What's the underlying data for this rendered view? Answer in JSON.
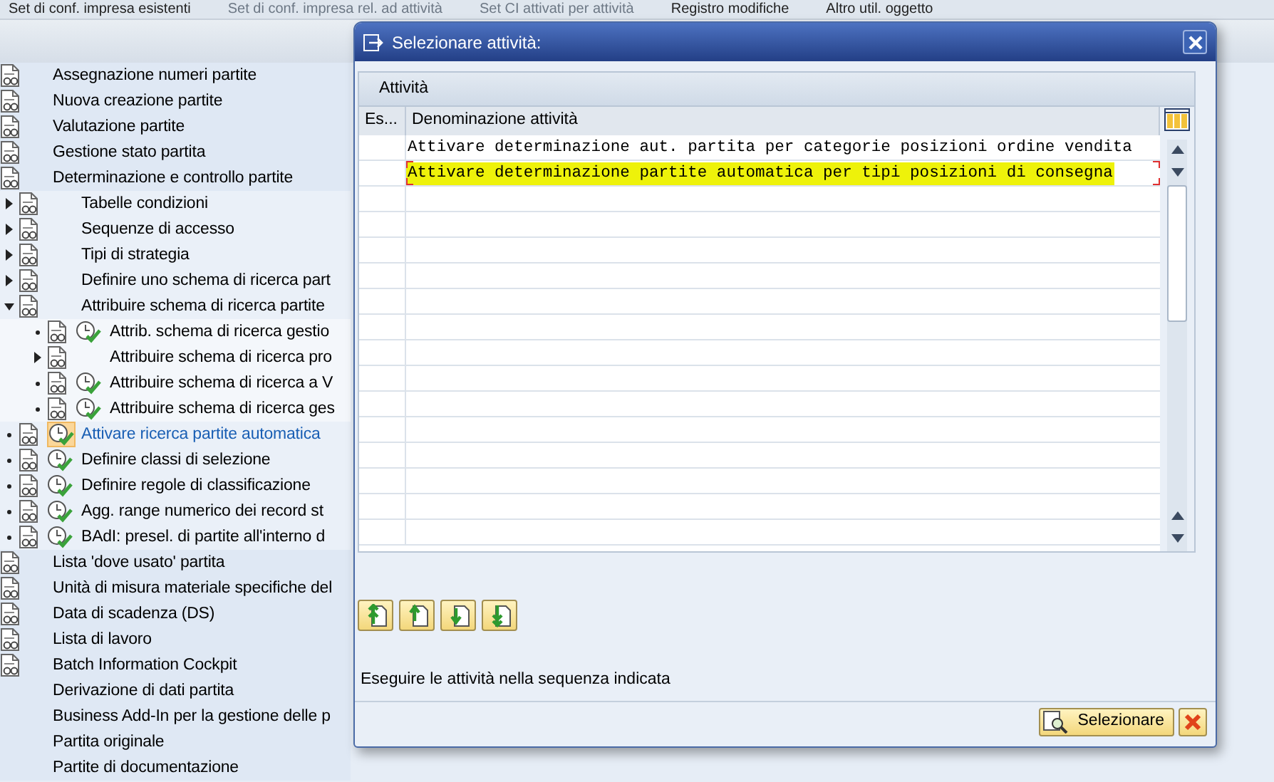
{
  "toolbar": [
    "Set di conf. impresa esistenti",
    "Set di conf. impresa rel. ad attività",
    "Set CI attivati per attività",
    "Registro modifiche",
    "Altro util. oggetto"
  ],
  "tree": [
    {
      "label": "Assegnazione numeri partite",
      "kind": "doc",
      "selected": false
    },
    {
      "label": "Nuova creazione partite",
      "kind": "doc",
      "selected": false
    },
    {
      "label": "Valutazione partite",
      "kind": "doc",
      "selected": false
    },
    {
      "label": "Gestione stato partita",
      "kind": "doc",
      "selected": false
    },
    {
      "label": "Determinazione e controllo partite",
      "kind": "doc",
      "selected": false,
      "children": [
        {
          "label": "Tabelle condizioni",
          "kind": "doc",
          "expanded": false,
          "selected": false
        },
        {
          "label": "Sequenze di accesso",
          "kind": "doc",
          "expanded": false,
          "selected": false
        },
        {
          "label": "Tipi di strategia",
          "kind": "doc",
          "expanded": false,
          "selected": false
        },
        {
          "label": "Definire uno schema di ricerca part",
          "kind": "doc",
          "expanded": false,
          "selected": false
        },
        {
          "label": "Attribuire schema di ricerca partite",
          "kind": "doc",
          "expanded": true,
          "selected": false,
          "children": [
            {
              "label": "Attrib. schema di ricerca gestio",
              "kind": "activity",
              "selected": false
            },
            {
              "label": "Attribuire schema di ricerca pro",
              "kind": "doc",
              "expanded": false,
              "selected": false
            },
            {
              "label": "Attribuire schema di ricerca a V",
              "kind": "activity",
              "selected": false
            },
            {
              "label": "Attribuire schema di ricerca ges",
              "kind": "activity",
              "selected": false
            }
          ]
        },
        {
          "label": "Attivare ricerca partite automatica",
          "kind": "activity",
          "selected": true
        },
        {
          "label": "Definire classi di selezione",
          "kind": "activity",
          "selected": false
        },
        {
          "label": "Definire regole di classificazione",
          "kind": "activity",
          "selected": false
        },
        {
          "label": "Agg. range numerico dei record st",
          "kind": "activity",
          "selected": false
        },
        {
          "label": "BAdI: presel. di partite all'interno d",
          "kind": "activity",
          "selected": false
        }
      ]
    },
    {
      "label": "Lista 'dove usato' partita",
      "kind": "doc",
      "selected": false
    },
    {
      "label": "Unità di misura materiale specifiche del",
      "kind": "doc",
      "selected": false
    },
    {
      "label": "Data di scadenza (DS)",
      "kind": "doc",
      "selected": false
    },
    {
      "label": "Lista di lavoro",
      "kind": "doc",
      "selected": false
    },
    {
      "label": "Batch Information Cockpit",
      "kind": "doc",
      "selected": false
    },
    {
      "label": "Derivazione di dati partita",
      "kind": "plain",
      "selected": false
    },
    {
      "label": "Business Add-In per la gestione delle p",
      "kind": "plain",
      "selected": false
    },
    {
      "label": "Partita originale",
      "kind": "plain",
      "selected": false
    },
    {
      "label": "Partite di documentazione",
      "kind": "plain",
      "selected": false
    }
  ],
  "dialog": {
    "title": "Selezionare attività:",
    "section": "Attività",
    "columns": [
      "Es...",
      "Denominazione attività"
    ],
    "rows": [
      {
        "label": "Attivare determinazione aut. partita per categorie posizioni ordine vendita",
        "selected": false,
        "highlighted": false
      },
      {
        "label": "Attivare determinazione partite automatica per tipi posizioni di consegna",
        "selected": true,
        "highlighted": true
      }
    ],
    "hint": "Eseguire le attività nella sequenza indicata",
    "confirm": "Selezionare"
  }
}
